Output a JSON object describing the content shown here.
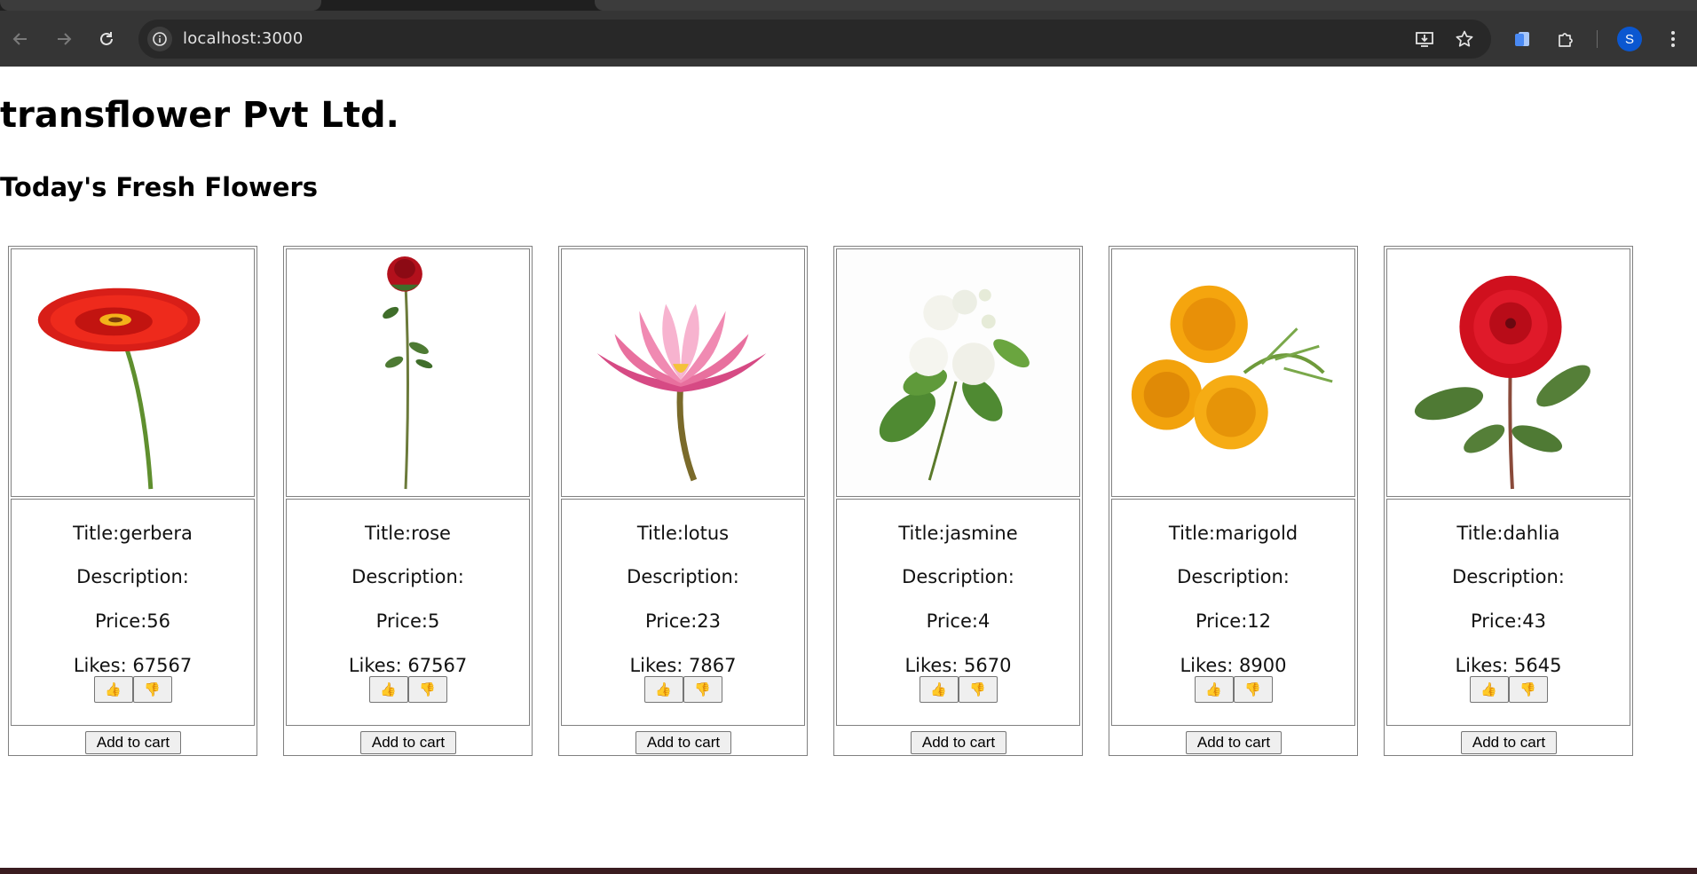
{
  "browser": {
    "url": "localhost:3000",
    "profile_initial": "S",
    "icons": [
      "back-arrow-icon",
      "forward-arrow-icon",
      "reload-icon",
      "site-info-icon",
      "install-app-icon",
      "bookmark-star-icon",
      "notes-icon",
      "extensions-puzzle-icon",
      "more-vertical-icon"
    ]
  },
  "page": {
    "company": "transflower Pvt Ltd.",
    "section_heading": "Today's Fresh Flowers"
  },
  "labels": {
    "title_prefix": "Title:",
    "description_prefix": "Description:",
    "price_prefix": "Price:",
    "likes_prefix": "Likes: ",
    "like_icon": "👍",
    "dislike_icon": "👎",
    "add_to_cart": "Add to cart"
  },
  "flowers": [
    {
      "title": "gerbera",
      "description": "",
      "price": "56",
      "likes": "67567",
      "line_title": "Title:gerbera",
      "line_desc": "Description:",
      "line_price": "Price:56",
      "line_likes": "Likes: 67567",
      "image": "red-gerbera-image",
      "color": "#e0201a"
    },
    {
      "title": "rose",
      "description": "",
      "price": "5",
      "likes": "67567",
      "line_title": "Title:rose",
      "line_desc": "Description:",
      "line_price": "Price:5",
      "line_likes": "Likes: 67567",
      "image": "red-rose-image",
      "color": "#b5101c"
    },
    {
      "title": "lotus",
      "description": "",
      "price": "23",
      "likes": "7867",
      "line_title": "Title:lotus",
      "line_desc": "Description:",
      "line_price": "Price:23",
      "line_likes": "Likes: 7867",
      "image": "pink-lotus-image",
      "color": "#e86a9a"
    },
    {
      "title": "jasmine",
      "description": "",
      "price": "4",
      "likes": "5670",
      "line_title": "Title:jasmine",
      "line_desc": "Description:",
      "line_price": "Price:4",
      "line_likes": "Likes: 5670",
      "image": "white-jasmine-image",
      "color": "#f4f4ee"
    },
    {
      "title": "marigold",
      "description": "",
      "price": "12",
      "likes": "8900",
      "line_title": "Title:marigold",
      "line_desc": "Description:",
      "line_price": "Price:12",
      "line_likes": "Likes: 8900",
      "image": "yellow-marigold-image",
      "color": "#f4a512"
    },
    {
      "title": "dahlia",
      "description": "",
      "price": "43",
      "likes": "5645",
      "line_title": "Title:dahlia",
      "line_desc": "Description:",
      "line_price": "Price:43",
      "line_likes": "Likes: 5645",
      "image": "red-dahlia-image",
      "color": "#d8102a"
    }
  ]
}
